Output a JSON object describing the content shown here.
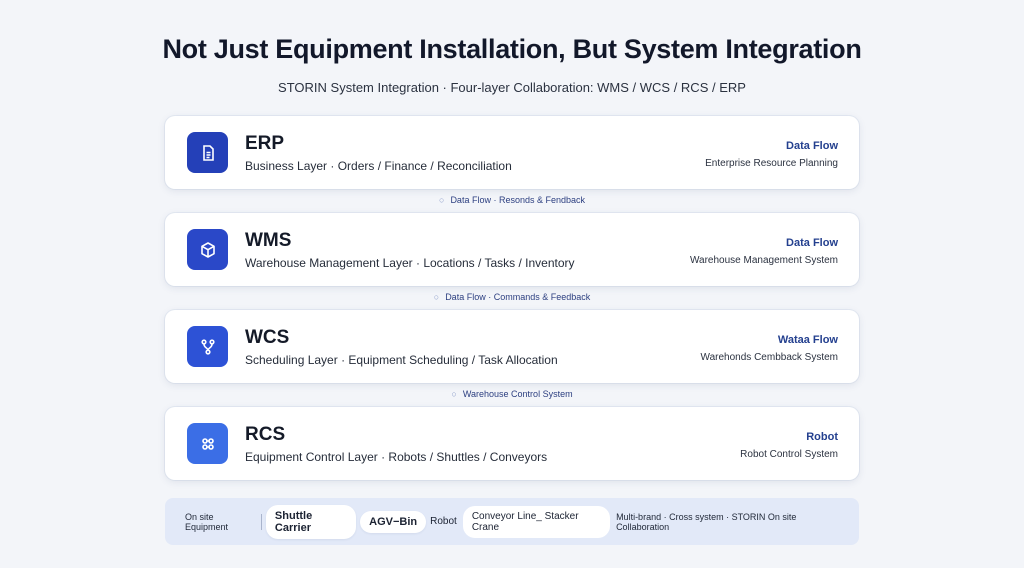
{
  "header": {
    "title": "Not Just Equipment Installation, But System Integration",
    "subtitle": "STORIN System Integration · Four-layer Collaboration: WMS / WCS / RCS / ERP"
  },
  "layers": [
    {
      "icon": "document-icon",
      "name": "ERP",
      "desc": "Business Layer · Orders / Finance / Reconciliation",
      "tag": "Data Flow",
      "system": "Enterprise Resource Planning",
      "color": "#2440b8"
    },
    {
      "icon": "cube-icon",
      "name": "WMS",
      "desc": "Warehouse Management Layer · Locations / Tasks / Inventory",
      "tag": "Data Flow",
      "system": "Warehouse Management System",
      "color": "#2a48c8"
    },
    {
      "icon": "branch-icon",
      "name": "WCS",
      "desc": "Scheduling Layer · Equipment Scheduling / Task Allocation",
      "tag": "Wataa Flow",
      "system": "Warehonds Cembback System",
      "color": "#2d52d6"
    },
    {
      "icon": "robot-icon",
      "name": "RCS",
      "desc": "Equipment Control Layer · Robots / Shuttles / Conveyors",
      "tag": "Robot",
      "system": "Robot Control System",
      "color": "#3b6ee6"
    }
  ],
  "connectors": [
    "Data Flow · Resonds & Fendback",
    "Data Flow · Commands & Feedback",
    "Warehouse Control System"
  ],
  "footer": {
    "label": "On site Equipment",
    "chips": [
      "Shuttle Carrier",
      "AGV−Bin"
    ],
    "plain": "Robot",
    "light_chip": "Conveyor Line_ Stacker Crane",
    "right": "Multi-brand · Cross system · STORIN On site Collaboration"
  }
}
